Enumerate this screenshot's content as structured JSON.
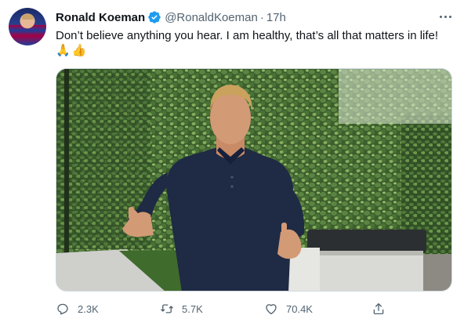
{
  "tweet": {
    "display_name": "Ronald Koeman",
    "handle": "@RonaldKoeman",
    "separator": "·",
    "time": "17h",
    "text": "Don’t believe anything you hear. I am healthy, that’s all that matters in life!",
    "emojis": [
      "🙏",
      "👍"
    ]
  },
  "actions": {
    "reply_count": "2.3K",
    "retweet_count": "5.7K",
    "like_count": "70.4K"
  },
  "colors": {
    "verified": "#1d9bf0",
    "secondary_text": "#536471",
    "primary_text": "#0f1419"
  },
  "icons": [
    "verified-badge-icon",
    "more-options-icon",
    "reply-icon",
    "retweet-icon",
    "like-icon",
    "share-icon"
  ]
}
